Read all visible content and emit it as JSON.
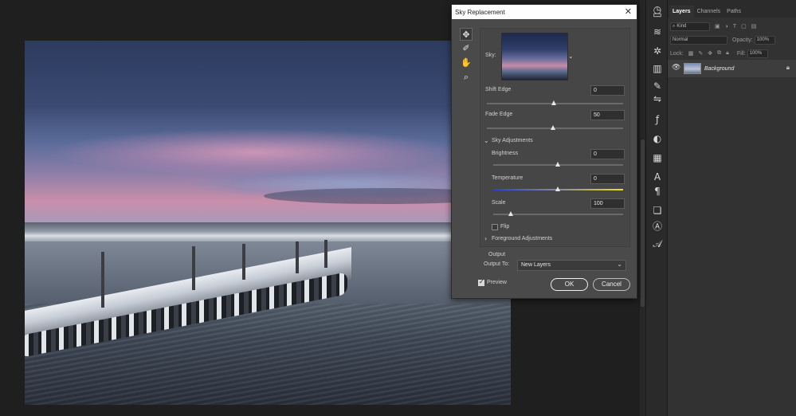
{
  "dialog": {
    "title": "Sky Replacement",
    "sky_label": "Sky:",
    "shift_edge": {
      "label": "Shift Edge",
      "value": "0"
    },
    "fade_edge": {
      "label": "Fade Edge",
      "value": "50"
    },
    "sky_adjustments_label": "Sky Adjustments",
    "brightness": {
      "label": "Brightness",
      "value": "0"
    },
    "temperature": {
      "label": "Temperature",
      "value": "0"
    },
    "scale": {
      "label": "Scale",
      "value": "100"
    },
    "flip_label": "Flip",
    "flip_checked": false,
    "foreground_adjustments_label": "Foreground Adjustments",
    "output_label": "Output",
    "output_to_label": "Output To:",
    "output_to_value": "New Layers",
    "preview_label": "Preview",
    "preview_checked": true,
    "ok_label": "OK",
    "cancel_label": "Cancel"
  },
  "layers_panel": {
    "tabs": [
      "Layers",
      "Channels",
      "Paths"
    ],
    "filter_label": "Kind",
    "blend_mode": "Normal",
    "opacity_label": "Opacity:",
    "opacity_value": "100%",
    "lock_label": "Lock:",
    "fill_label": "Fill:",
    "fill_value": "100%",
    "layers": [
      {
        "name": "Background",
        "visible": true,
        "locked": true
      }
    ]
  }
}
